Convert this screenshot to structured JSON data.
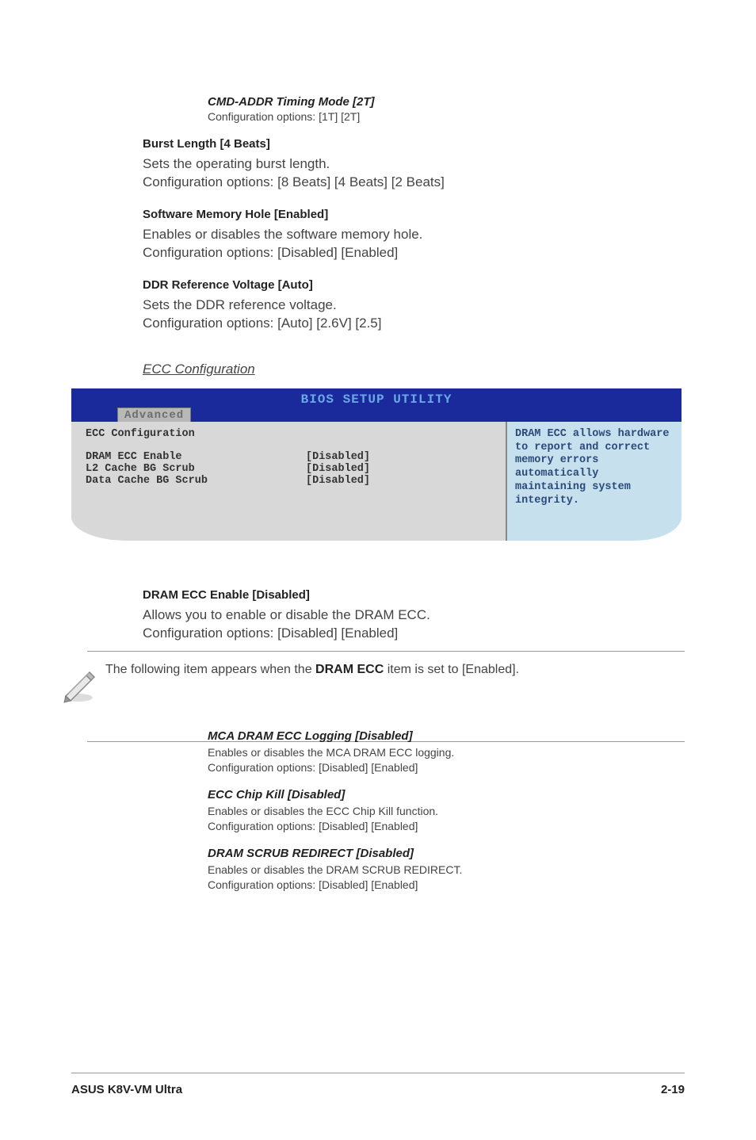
{
  "cmd_addr": {
    "heading": "CMD-ADDR Timing Mode [2T]",
    "body": "Configuration options: [1T] [2T]"
  },
  "burst": {
    "heading": "Burst Length [4 Beats]",
    "l1": "Sets the operating burst length.",
    "l2": "Configuration options: [8 Beats] [4 Beats] [2 Beats]"
  },
  "swmem": {
    "heading": "Software Memory Hole [Enabled]",
    "l1": "Enables or disables the software memory hole.",
    "l2": "Configuration options: [Disabled] [Enabled]"
  },
  "ddr": {
    "heading": "DDR Reference Voltage [Auto]",
    "l1": "Sets the DDR reference voltage.",
    "l2": "Configuration options: [Auto] [2.6V] [2.5]"
  },
  "ecc_section": "ECC Configuration",
  "bios": {
    "title": "BIOS SETUP UTILITY",
    "tab": "Advanced",
    "panel_title": "ECC Configuration",
    "rows": [
      {
        "label": "DRAM ECC Enable",
        "value": "[Disabled]"
      },
      {
        "label": "L2 Cache BG Scrub",
        "value": "[Disabled]"
      },
      {
        "label": "Data Cache BG Scrub",
        "value": "[Disabled]"
      }
    ],
    "help": "DRAM ECC allows hardware to report and correct memory errors automatically maintaining system integrity."
  },
  "dram_ecc": {
    "heading": "DRAM ECC Enable [Disabled]",
    "l1": "Allows you to enable or disable the DRAM ECC.",
    "l2": "Configuration options: [Disabled] [Enabled]"
  },
  "note": {
    "pre": "The following item appears when the ",
    "bold": "DRAM ECC",
    "post": " item is set to [Enabled]."
  },
  "mca": {
    "heading": "MCA DRAM ECC Logging [Disabled]",
    "l1": "Enables or disables the MCA DRAM ECC logging.",
    "l2": "Configuration options: [Disabled] [Enabled]"
  },
  "chipkill": {
    "heading": "ECC Chip Kill [Disabled]",
    "l1": "Enables or disables the ECC Chip Kill function.",
    "l2": "Configuration options: [Disabled] [Enabled]"
  },
  "scrub": {
    "heading": "DRAM SCRUB REDIRECT [Disabled]",
    "l1": "Enables or disables the DRAM SCRUB REDIRECT.",
    "l2": "Configuration options: [Disabled] [Enabled]"
  },
  "footer": {
    "left": "ASUS K8V-VM Ultra",
    "right": "2-19"
  }
}
